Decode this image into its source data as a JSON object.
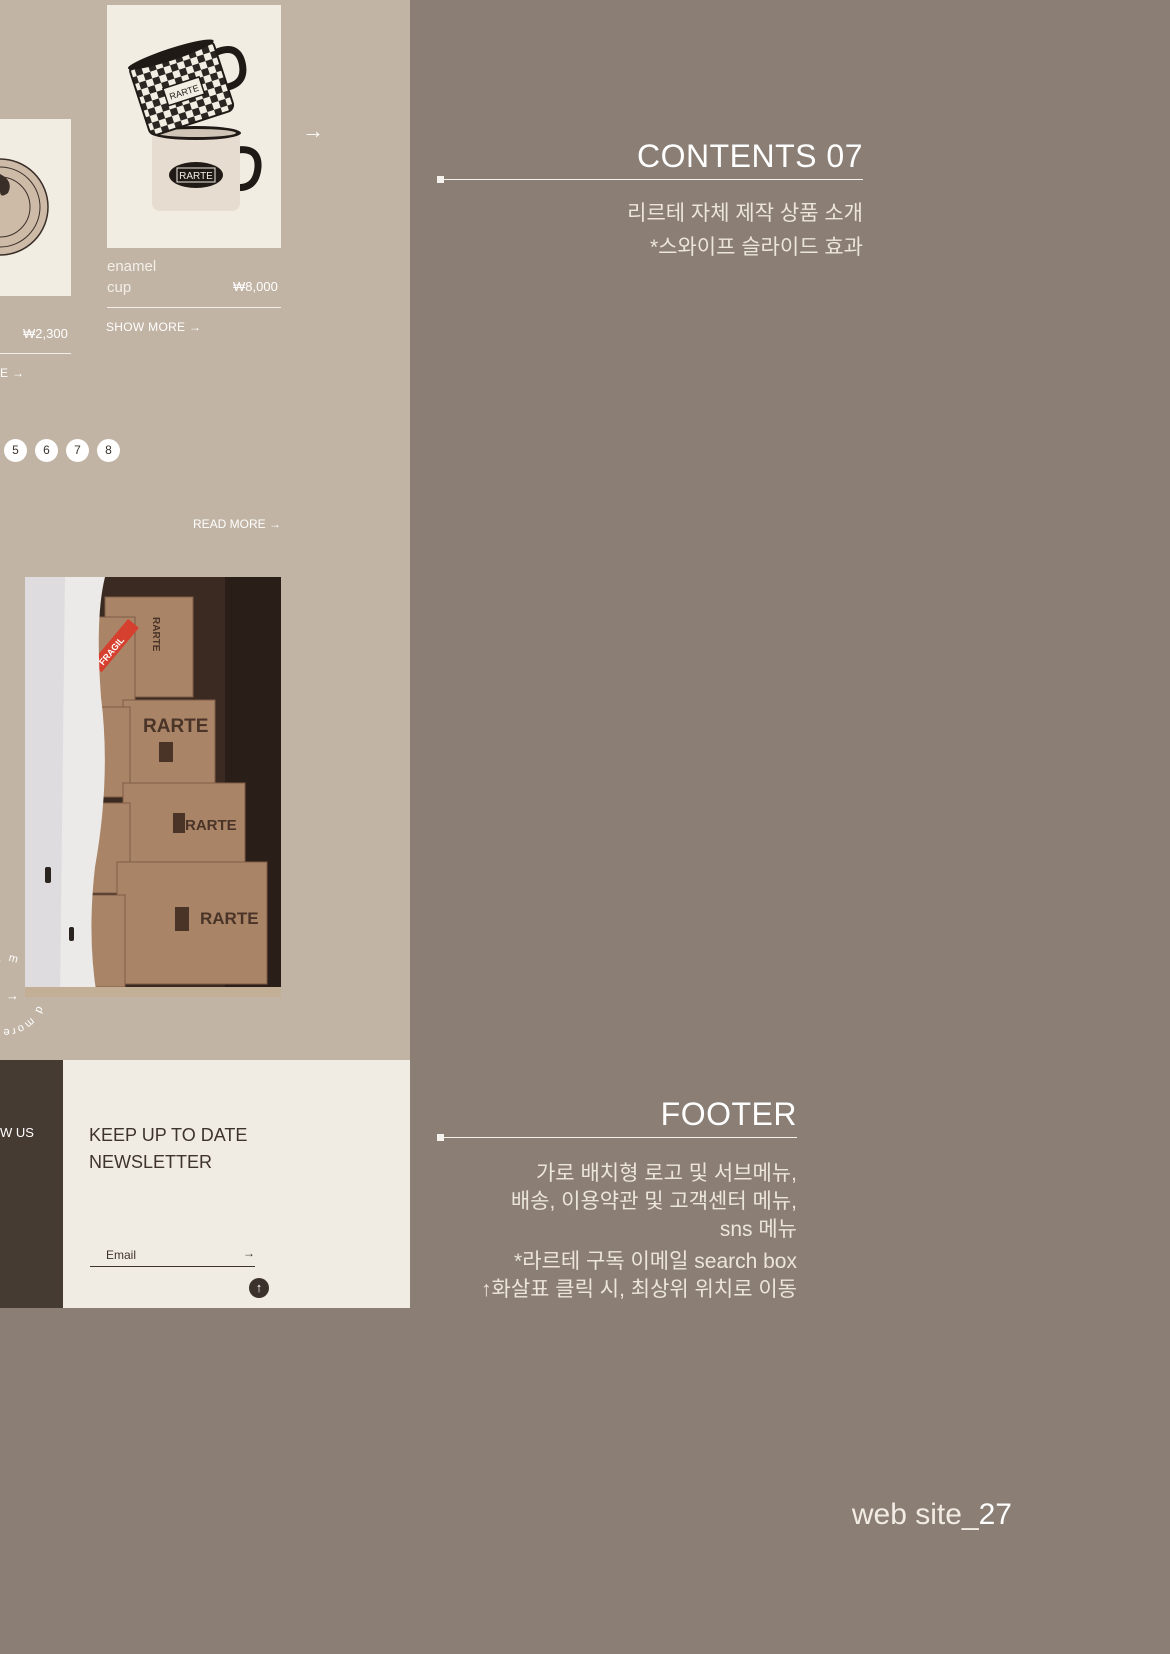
{
  "products": [
    {
      "name_line1": "",
      "name_line2": "",
      "price": "₩2,300",
      "more": "E →"
    },
    {
      "name_line1": "enamel",
      "name_line2": "cup",
      "price": "₩8,000",
      "more": "SHOW MORE →",
      "brand": "RARTE"
    }
  ],
  "slider_next": "→",
  "pagination": [
    "5",
    "6",
    "7",
    "8"
  ],
  "read_more": "READ MORE →",
  "photo": {
    "brand": "RARTE",
    "sticker": "FRAGIL"
  },
  "circle_text": {
    "top": "d more",
    "bottom": "read m",
    "arrow": "→"
  },
  "footer": {
    "follow": "W US",
    "newsletter_line1": "KEEP UP TO DATE",
    "newsletter_line2": "NEWSLETTER",
    "email_placeholder": "Email",
    "email_arrow": "→",
    "top_arrow": "↑"
  },
  "annotations": {
    "contents": {
      "title": "CONTENTS 07",
      "lines": [
        "리르테 자체 제작 상품 소개",
        "*스와이프 슬라이드 효과"
      ]
    },
    "footer": {
      "title": "FOOTER",
      "lines": [
        "가로 배치형 로고 및 서브메뉴,",
        "배송, 이용약관 및 고객센터 메뉴,",
        "sns 메뉴",
        "*라르테 구독 이메일 search box",
        "↑화살표 클릭 시, 최상위 위치로 이동"
      ]
    }
  },
  "page_label": {
    "prefix": "web site_",
    "number": "27"
  }
}
